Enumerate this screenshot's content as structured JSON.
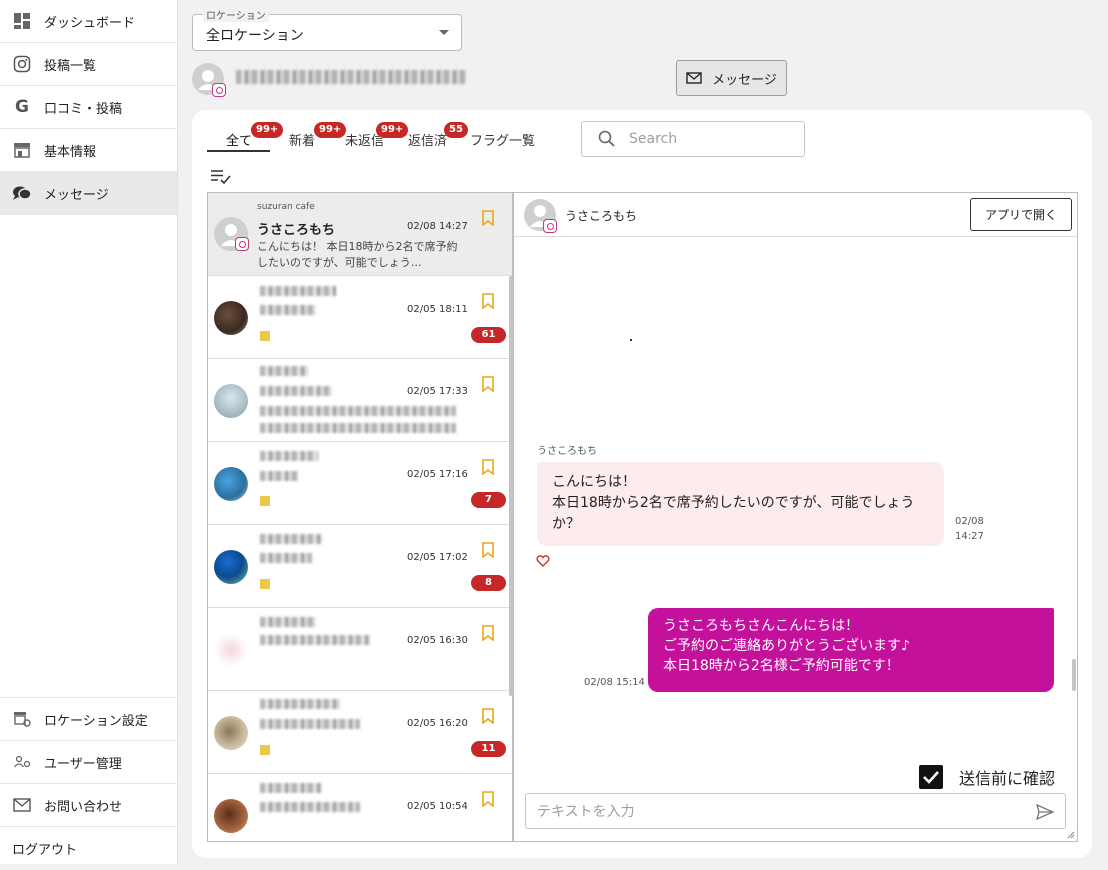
{
  "sidebar": {
    "items": [
      {
        "label": "ダッシュボード",
        "icon": "dashboard-icon"
      },
      {
        "label": "投稿一覧",
        "icon": "instagram-icon"
      },
      {
        "label": "口コミ・投稿",
        "icon": "google-icon"
      },
      {
        "label": "基本情報",
        "icon": "store-icon"
      },
      {
        "label": "メッセージ",
        "icon": "chat-bubbles-icon",
        "active": true
      }
    ],
    "bottom": [
      {
        "label": "ロケーション設定",
        "icon": "store-gear-icon"
      },
      {
        "label": "ユーザー管理",
        "icon": "users-gear-icon"
      },
      {
        "label": "お問い合わせ",
        "icon": "mail-icon"
      },
      {
        "label": "ログアウト"
      }
    ]
  },
  "location": {
    "legend": "ロケーション",
    "value": "全ロケーション"
  },
  "header": {
    "message_button": "メッセージ"
  },
  "tabs": [
    {
      "label": "全て",
      "badge": "99+",
      "active": true
    },
    {
      "label": "新着",
      "badge": "99+"
    },
    {
      "label": "未返信",
      "badge": "99+"
    },
    {
      "label": "返信済",
      "badge": "55"
    },
    {
      "label": "フラグ一覧"
    }
  ],
  "search": {
    "placeholder": "Search"
  },
  "conversations": [
    {
      "store": "suzuran cafe",
      "name": "うさころもち",
      "time": "02/08 14:27",
      "preview": "こんにちは！ 本日18時から2名で席予約したいのですが、可能でしょう…"
    },
    {
      "time": "02/05 18:11",
      "count": "61"
    },
    {
      "time": "02/05 17:33"
    },
    {
      "time": "02/05 17:16",
      "count": "7"
    },
    {
      "time": "02/05 17:02",
      "count": "8"
    },
    {
      "time": "02/05 16:30"
    },
    {
      "time": "02/05 16:20",
      "count": "11"
    },
    {
      "time": "02/05 10:54"
    }
  ],
  "chat": {
    "name": "うさころもち",
    "open_app": "アプリで開く",
    "incoming_sender": "うさころもち",
    "incoming_text": "こんにちは！\n本日18時から2名で席予約したいのですが、可能でしょうか？",
    "incoming_date": "02/08",
    "incoming_time": "14:27",
    "outgoing_text": "うさころもちさんこんにちは！\nご予約のご連絡ありがとうございます♪\n本日18時から2名様ご予約可能です！",
    "outgoing_time": "02/08 15:14",
    "confirm_label": "送信前に確認",
    "input_placeholder": "テキストを入力"
  },
  "colors": {
    "accent": "#c4119c",
    "badge": "#c62828",
    "incoming_bubble": "#fdecee",
    "bookmark": "#e6a817"
  }
}
